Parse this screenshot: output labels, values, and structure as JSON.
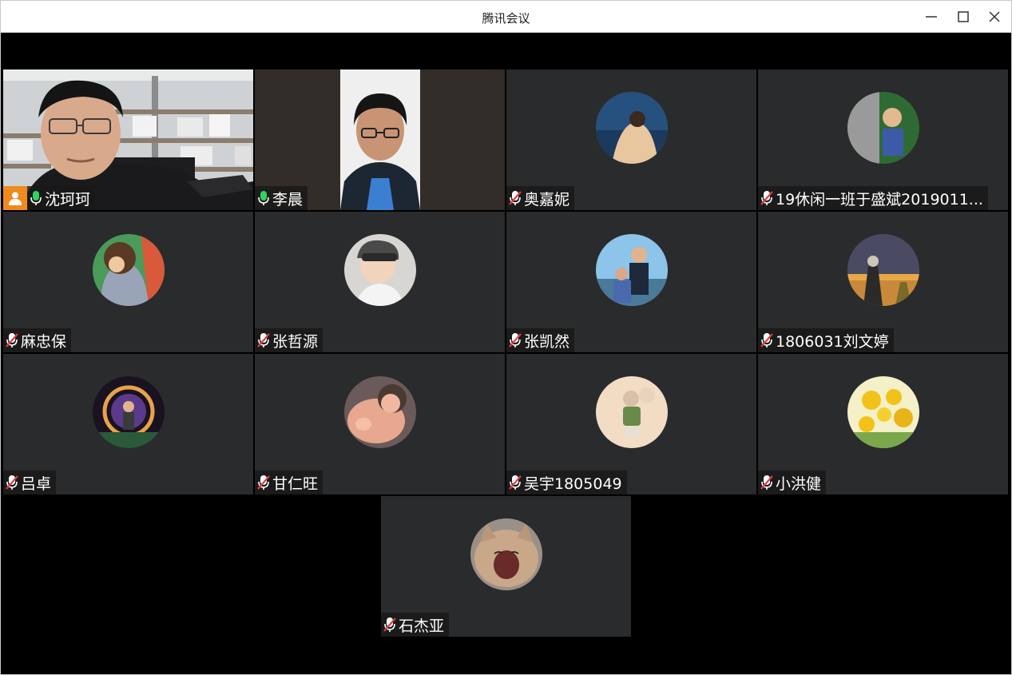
{
  "window": {
    "title": "腾讯会议",
    "controls": [
      "minimize-icon",
      "maximize-icon",
      "close-icon"
    ]
  },
  "colors": {
    "tile_bg": "#2a2b2d",
    "stage_bg": "#000000",
    "active_border": "#29c46b",
    "host_badge": "#f08a1d",
    "mic_on": "#2fd35e",
    "mic_off": "#e23b3b"
  },
  "participants": [
    {
      "name": "沈珂珂",
      "mic": "on",
      "host": true,
      "video": true
    },
    {
      "name": "李晨",
      "mic": "on",
      "host": false,
      "video": true
    },
    {
      "name": "奥嘉妮",
      "mic": "muted",
      "host": false,
      "video": false
    },
    {
      "name": "19休闲一班于盛斌2019011...",
      "mic": "muted",
      "host": false,
      "video": false
    },
    {
      "name": "麻忠保",
      "mic": "muted",
      "host": false,
      "video": false
    },
    {
      "name": "张哲源",
      "mic": "muted",
      "host": false,
      "video": false
    },
    {
      "name": "张凯然",
      "mic": "muted",
      "host": false,
      "video": false
    },
    {
      "name": "1806031刘文婷",
      "mic": "muted",
      "host": false,
      "video": false
    },
    {
      "name": "吕卓",
      "mic": "muted",
      "host": false,
      "video": false
    },
    {
      "name": "甘仁旺",
      "mic": "muted",
      "host": false,
      "video": false
    },
    {
      "name": "吴宇1805049",
      "mic": "muted",
      "host": false,
      "video": false
    },
    {
      "name": "小洪健",
      "mic": "muted",
      "host": false,
      "video": false
    },
    {
      "name": "石杰亚",
      "mic": "muted",
      "host": false,
      "video": false
    }
  ]
}
